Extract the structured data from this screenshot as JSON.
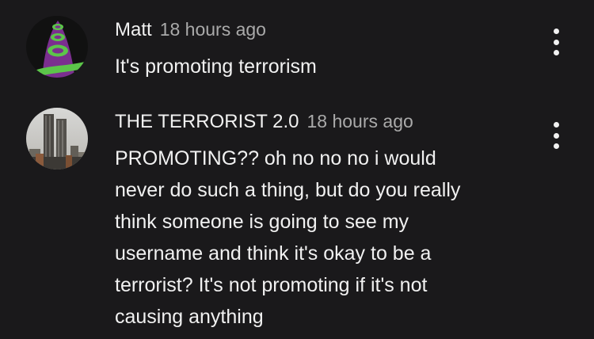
{
  "comments": [
    {
      "author": "Matt",
      "time": "18 hours ago",
      "text": "It's promoting terrorism",
      "avatar_icon": "purple-tentacle-icon",
      "menu_icon": "more-vert-icon"
    },
    {
      "author": "THE TERRORIST 2.0",
      "time": "18 hours ago",
      "text": "PROMOTING?? oh no no no i would\nnever do such a thing, but do you really\nthink someone is going to see my\nusername and think it's okay to be a\nterrorist? It's not promoting if it's not\ncausing anything",
      "avatar_icon": "twin-towers-icon",
      "menu_icon": "more-vert-icon"
    }
  ],
  "colors": {
    "background": "#1a191b",
    "primary_text": "#f1f1f1",
    "secondary_text": "#aaaaaa",
    "tentacle_purple": "#7b2f8f",
    "tentacle_green": "#5cc54a"
  }
}
